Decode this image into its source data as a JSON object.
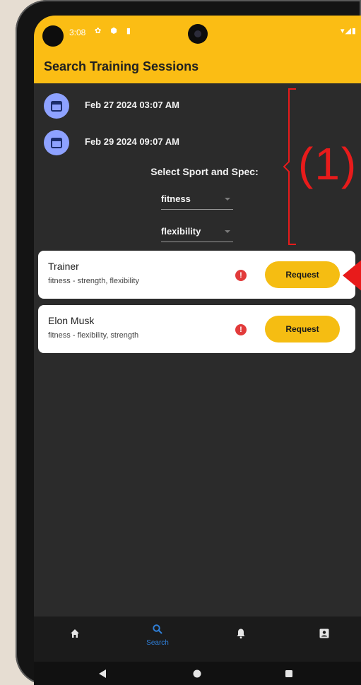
{
  "status_bar": {
    "time": "3:08",
    "icons": "✿ ⬢ ▮",
    "signal": "▾◢▮"
  },
  "header": {
    "title": "Search Training Sessions"
  },
  "dates": [
    {
      "label": "Feb 27 2024 03:07 AM",
      "icon": "calendar-icon"
    },
    {
      "label": "Feb 29 2024 09:07 AM",
      "icon": "calendar-icon"
    }
  ],
  "filters": {
    "label": "Select Sport and Spec:",
    "sport": "fitness",
    "spec": "flexibility"
  },
  "annotation": {
    "label": "(1)",
    "color": "#e81b1b"
  },
  "results": [
    {
      "name": "Trainer",
      "specs": "fitness - strength, flexibility",
      "button": "Request"
    },
    {
      "name": "Elon Musk",
      "specs": "fitness - flexibility, strength",
      "button": "Request"
    }
  ],
  "nav": {
    "items": [
      {
        "icon": "home-icon",
        "label": ""
      },
      {
        "icon": "search-icon",
        "label": "Search",
        "active": true
      },
      {
        "icon": "bell-icon",
        "label": ""
      },
      {
        "icon": "profile-icon",
        "label": ""
      }
    ]
  },
  "colors": {
    "accent": "#fbbd14",
    "button": "#f5bd12",
    "background": "#2b2b2b",
    "active_nav": "#2f7fd8",
    "info": "#e23b3b",
    "calendar_bg": "#8ea2ff"
  }
}
